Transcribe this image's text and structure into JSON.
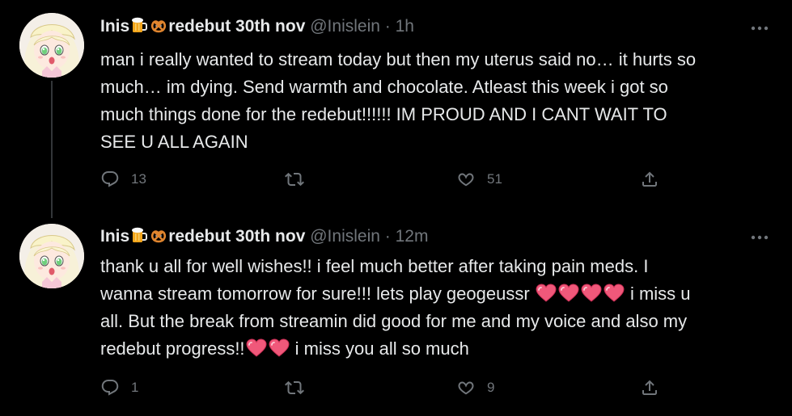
{
  "tweets": [
    {
      "name": "Inis",
      "name_suffix": "redebut 30th nov",
      "handle": "@Inislein",
      "separator": "·",
      "time": "1h",
      "text_line1": "man i really wanted to stream today but then my uterus said no… it hurts so",
      "text_line2": "much… im dying. Send warmth and chocolate. Atleast this week i got so",
      "text_line3": "much things done for the redebut!!!!!! IM PROUD AND I CANT WAIT TO",
      "text_line4": "SEE U ALL AGAIN",
      "reply_count": "13",
      "retweet_count": "",
      "like_count": "51"
    },
    {
      "name": "Inis",
      "name_suffix": "redebut 30th nov",
      "handle": "@Inislein",
      "separator": "·",
      "time": "12m",
      "text_line1": "thank u all for well wishes!! i feel much better after taking pain meds. I",
      "text_line2_a": "wanna stream tomorrow for sure!!! lets play geogeussr",
      "text_line2_b": "i miss u",
      "text_line3": "all. But the break from streamin did good for me and my voice and also my",
      "text_line4_a": "redebut progress!!",
      "text_line4_b": "i miss you all so much",
      "reply_count": "1",
      "retweet_count": "",
      "like_count": "9"
    }
  ],
  "icons": {
    "beer": "beer-mug-icon",
    "pretzel": "pretzel-icon",
    "heart": "pink-heart-icon",
    "reply": "reply-icon",
    "retweet": "retweet-icon",
    "like": "like-icon",
    "share": "share-icon",
    "more": "more-icon"
  },
  "colors": {
    "background": "#000000",
    "text": "#e7e9ea",
    "muted": "#71767b",
    "thread_line": "#333639",
    "heart_pink": "#f0587a"
  }
}
